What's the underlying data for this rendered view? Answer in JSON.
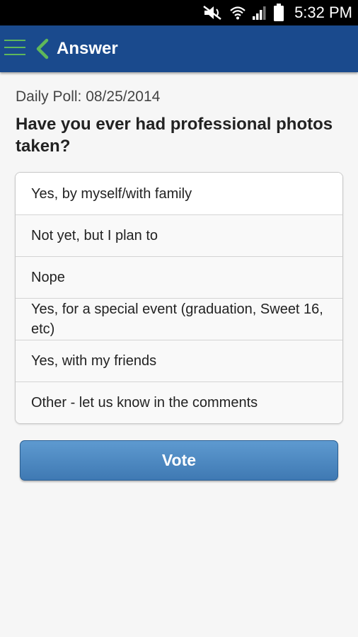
{
  "status_bar": {
    "time": "5:32 PM",
    "icons": [
      "mute-icon",
      "wifi-icon",
      "signal-icon",
      "battery-icon"
    ]
  },
  "app_bar": {
    "title": "Answer",
    "background_color": "#1a4a8d",
    "accent_color": "#5fb85a"
  },
  "poll": {
    "date_label": "Daily Poll: 08/25/2014",
    "question": "Have you ever had professional photos taken?",
    "options": [
      "Yes, by myself/with family",
      "Not yet, but I plan to",
      "Nope",
      "Yes, for a special event (graduation, Sweet 16, etc)",
      "Yes, with my friends",
      "Other - let us know in the comments"
    ],
    "vote_label": "Vote"
  }
}
